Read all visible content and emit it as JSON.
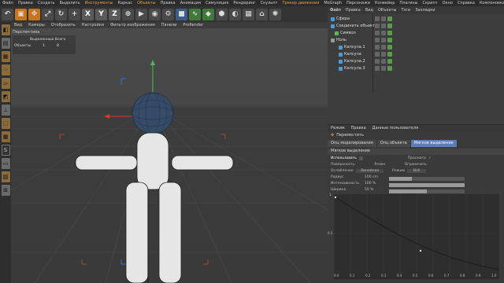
{
  "menubar": {
    "items": [
      "Файл",
      "Правка",
      "Создать",
      "Выделить",
      "Инструменты",
      "Каркас",
      "Объекты",
      "Правка",
      "Анимация",
      "Симуляция",
      "Рендеринг",
      "Скульпт",
      "Трекер движения",
      "MoGraph",
      "Персонажи",
      "Конвейер",
      "Плагины",
      "Скрипт",
      "Окно",
      "Справка"
    ],
    "highlighted": [
      "Инструменты",
      "Объекты",
      "Трекер движения"
    ],
    "layout_label": "Компоновка:",
    "layout_value": "Model"
  },
  "toolbar": {
    "axis_x": "X",
    "axis_y": "Y",
    "axis_z": "Z"
  },
  "viewport": {
    "menu": [
      "Вид",
      "Камеры",
      "Отобразить",
      "Настройки",
      "Фильтр изображения",
      "Панели",
      "ProRender"
    ],
    "label": "Перспектива",
    "stats_header": "Выделенные Всего",
    "stats_row_label": "Объекты",
    "stats_selected": "1",
    "stats_total": "8"
  },
  "object_manager": {
    "menu": [
      "Файл",
      "Правка",
      "Вид",
      "Объекты",
      "Тэги",
      "Закладки"
    ],
    "objects": [
      {
        "name": "Сфера",
        "indent": 0,
        "color": "#4a9bd9"
      },
      {
        "name": "Соединить объекты",
        "indent": 0,
        "color": "#4a9bd9"
      },
      {
        "name": "Символ",
        "indent": 1,
        "color": "#5cb85c"
      },
      {
        "name": "Ноль",
        "indent": 0,
        "color": "#9a9a9a"
      },
      {
        "name": "Капсула.1",
        "indent": 2,
        "color": "#4a9bd9"
      },
      {
        "name": "Капсула",
        "indent": 2,
        "color": "#4a9bd9"
      },
      {
        "name": "Капсула.2",
        "indent": 2,
        "color": "#4a9bd9"
      },
      {
        "name": "Капсула.3",
        "indent": 2,
        "color": "#4a9bd9"
      }
    ]
  },
  "attributes": {
    "menu": [
      "Режим",
      "Правка",
      "Данные пользователя"
    ],
    "tool_title": "Переместить",
    "tabs": [
      "Опц моделирования",
      "Опц объекта",
      "Мягкое выделение"
    ],
    "active_tab": "Мягкое выделение",
    "section": "Мягкое выделение",
    "use_label": "Использовать",
    "preview_label": "Просмотр",
    "surface_label": "Поверхность",
    "rubber_label": "Резин.",
    "restrict_label": "Ограничить",
    "falloff_label": "Ослабление",
    "falloff_value": "Линейное",
    "mode_label": "Режим",
    "mode_value": "Всё",
    "radius_label": "Радиус",
    "radius_value": "100 cm",
    "strength_label": "Интенсивность",
    "strength_value": "100 %",
    "width_label": "Ширина",
    "width_value": "50 %",
    "graph_y_top": "1",
    "graph_y_mid": "0.5",
    "graph_x_ticks": [
      "0.0",
      "0.1",
      "0.2",
      "0.3",
      "0.4",
      "0.5",
      "0.6",
      "0.7",
      "0.8",
      "0.9",
      "1.0"
    ],
    "radius_fraction": 0.3,
    "strength_fraction": 1.0,
    "width_fraction": 0.5
  }
}
